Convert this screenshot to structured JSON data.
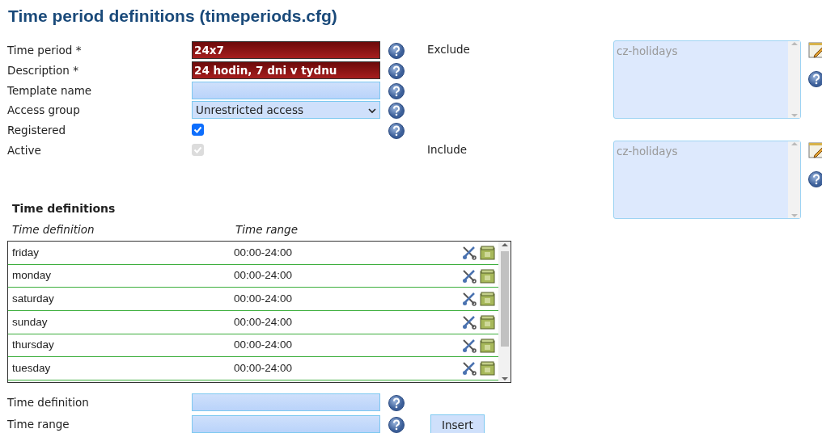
{
  "title": "Time period definitions (timeperiods.cfg)",
  "fields": [
    {
      "kind": "required",
      "label": "Time period *",
      "value": "24x7"
    },
    {
      "kind": "required",
      "label": "Description *",
      "value": "24 hodin, 7 dni v tydnu"
    },
    {
      "kind": "text",
      "label": "Template name"
    },
    {
      "kind": "select",
      "label": "Access group",
      "value": "Unrestricted access"
    },
    {
      "kind": "checkbox",
      "label": "Registered",
      "checked": true,
      "disabled": false,
      "help": true
    },
    {
      "kind": "checkbox",
      "label": "Active",
      "checked": true,
      "disabled": true,
      "help": false
    }
  ],
  "lists": [
    {
      "label": "Exclude",
      "items": [
        "cz-holidays"
      ]
    },
    {
      "label": "Include",
      "items": [
        "cz-holidays"
      ]
    }
  ],
  "time_definitions": {
    "heading": "Time definitions",
    "columns": [
      "Time definition",
      "Time range"
    ],
    "rows": [
      {
        "definition": "friday",
        "range": "00:00-24:00"
      },
      {
        "definition": "monday",
        "range": "00:00-24:00"
      },
      {
        "definition": "saturday",
        "range": "00:00-24:00"
      },
      {
        "definition": "sunday",
        "range": "00:00-24:00"
      },
      {
        "definition": "thursday",
        "range": "00:00-24:00"
      },
      {
        "definition": "tuesday",
        "range": "00:00-24:00"
      }
    ]
  },
  "new_definition": {
    "fields": [
      {
        "label": "Time definition"
      },
      {
        "label": "Time range"
      }
    ],
    "button": "Insert"
  }
}
